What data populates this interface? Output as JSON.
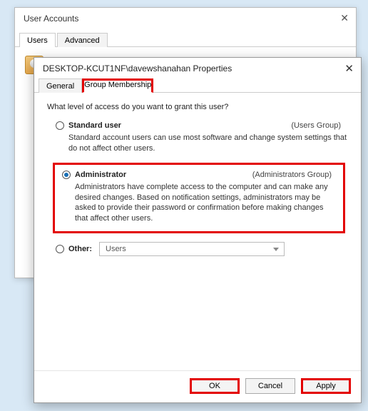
{
  "parent": {
    "title": "User Accounts",
    "tabs": {
      "users": "Users",
      "advanced": "Advanced"
    }
  },
  "props": {
    "title": "DESKTOP-KCUT1NF\\davewshanahan Properties",
    "tabs": {
      "general": "General",
      "group": "Group Membership"
    },
    "prompt": "What level of access do you want to grant this user?",
    "standard": {
      "label": "Standard user",
      "group": "(Users Group)",
      "desc": "Standard account users can use most software and change system settings that do not affect other users."
    },
    "admin": {
      "label": "Administrator",
      "group": "(Administrators Group)",
      "desc": "Administrators have complete access to the computer and can make any desired changes. Based on notification settings, administrators may be asked to provide their password or confirmation before making changes that affect other users."
    },
    "other": {
      "label": "Other:",
      "value": "Users"
    },
    "buttons": {
      "ok": "OK",
      "cancel": "Cancel",
      "apply": "Apply"
    }
  }
}
